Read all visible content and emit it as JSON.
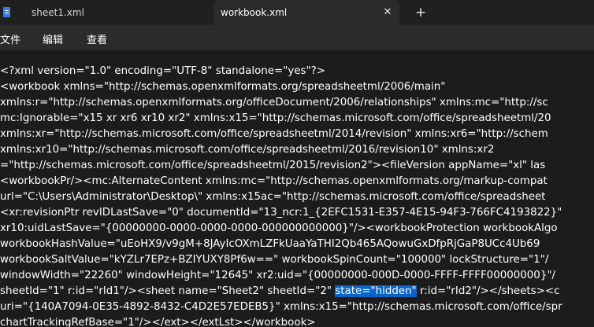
{
  "tabs": [
    {
      "label": "sheet1.xml",
      "icon": "notepad-icon"
    },
    {
      "label": "workbook.xml",
      "active": true,
      "close": "✕"
    }
  ],
  "new_tab": "+",
  "menu": [
    "文件",
    "编辑",
    "查看"
  ],
  "editor": {
    "lines": [
      {
        "text": "<?xml version=\"1.0\" encoding=\"UTF-8\" standalone=\"yes\"?>"
      },
      {
        "text": "<workbook xmlns=\"http://schemas.openxmlformats.org/spreadsheetml/2006/main\""
      },
      {
        "text": "xmlns:r=\"http://schemas.openxmlformats.org/officeDocument/2006/relationships\" xmlns:mc=\"http://sc"
      },
      {
        "text": "mc:Ignorable=\"x15 xr xr6 xr10 xr2\" xmlns:x15=\"http://schemas.microsoft.com/office/spreadsheetml/20"
      },
      {
        "text": "xmlns:xr=\"http://schemas.microsoft.com/office/spreadsheetml/2014/revision\" xmlns:xr6=\"http://schem"
      },
      {
        "text": "xmlns:xr10=\"http://schemas.microsoft.com/office/spreadsheetml/2016/revision10\" xmlns:xr2"
      },
      {
        "text": "=\"http://schemas.microsoft.com/office/spreadsheetml/2015/revision2\"><fileVersion appName=\"xl\" las"
      },
      {
        "text": "<workbookPr/><mc:AlternateContent xmlns:mc=\"http://schemas.openxmlformats.org/markup-compat"
      },
      {
        "text": "url=\"C:\\Users\\Administrator\\Desktop\\\" xmlns:x15ac=\"http://schemas.microsoft.com/office/spreadsheet"
      },
      {
        "text": "<xr:revisionPtr revIDLastSave=\"0\" documentId=\"13_ncr:1_{2EFC1531-E357-4E15-94F3-766FC4193822}\""
      },
      {
        "text": "xr10:uidLastSave=\"{00000000-0000-0000-0000-000000000000}\"/><workbookProtection workbookAlgo"
      },
      {
        "text": "workbookHashValue=\"uEoHX9/v9gM+8JAyIcOXmLZFkUaaYaTHI2Qb465AQowuGxDfpRjGaP8UCc4Ub69"
      },
      {
        "text": "workbookSaltValue=\"kYZLr7EPz+BZIYUXY8Pf6w==\" workbookSpinCount=\"100000\" lockStructure=\"1\"/"
      },
      {
        "text": "windowWidth=\"22260\" windowHeight=\"12645\" xr2:uid=\"{00000000-000D-0000-FFFF-FFFF00000000}\"/"
      },
      {
        "text": "sheetId=\"1\" r:id=\"rId1\"/><sheet name=\"Sheet2\" sheetId=\"2\" ",
        "selected": "state=\"hidden\"",
        "after": " r:id=\"rId2\"/></sheets><c"
      },
      {
        "text": "uri=\"{140A7094-0E35-4892-8432-C4D2E57EDEB5}\" xmlns:x15=\"http://schemas.microsoft.com/office/spr"
      },
      {
        "text": "chartTrackingRefBase=\"1\"/></ext></extLst></workbook>"
      }
    ]
  },
  "colors": {
    "background": "#1c1c1c",
    "tab_active": "#2b2b2b",
    "selection": "#0a64c8"
  }
}
